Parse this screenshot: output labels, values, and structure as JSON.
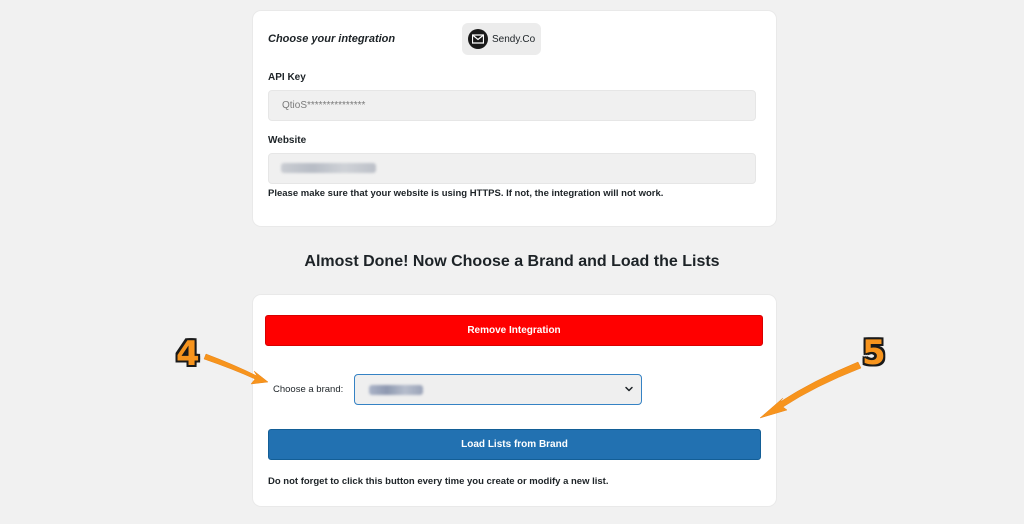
{
  "integration": {
    "label": "Choose your integration",
    "provider_name": "Sendy.Co",
    "provider_icon": "sendy-logo-icon"
  },
  "api_key": {
    "label": "API Key",
    "value": "QtioS***************"
  },
  "website": {
    "label": "Website",
    "note": "Please make sure that your website is using HTTPS. If not, the integration will not work."
  },
  "section": {
    "heading": "Almost Done! Now Choose a Brand and Load the Lists"
  },
  "actions": {
    "remove_label": "Remove Integration",
    "brand_label": "Choose a brand:",
    "load_label": "Load Lists from Brand",
    "load_note": "Do not forget to click this button every time you create or modify a new list."
  },
  "annotations": {
    "step_4": "4",
    "step_5": "5"
  },
  "colors": {
    "remove_button": "#ff0000",
    "load_button": "#2271b1",
    "annotation": "#f7941d"
  }
}
